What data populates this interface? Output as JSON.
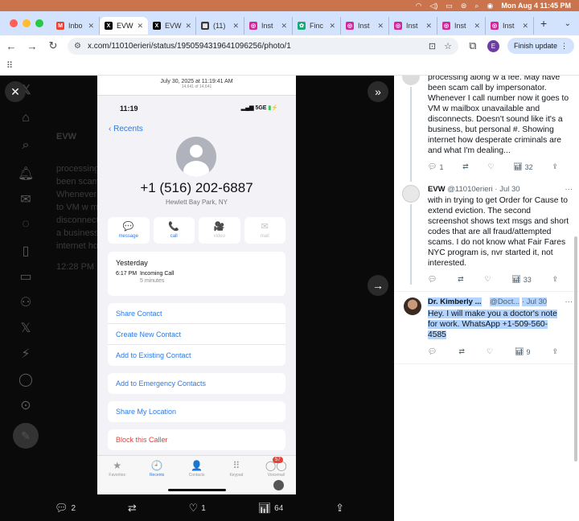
{
  "menubar": {
    "clock": "Mon Aug 4  11:45 PM"
  },
  "tabs": [
    {
      "label": "Inbo",
      "color": "#ea4335",
      "glyph": "M"
    },
    {
      "label": "EVW",
      "color": "#000000",
      "glyph": "X",
      "active": true
    },
    {
      "label": "EVW",
      "color": "#000000",
      "glyph": "X"
    },
    {
      "label": "(11)",
      "color": "#3b3b3b",
      "glyph": "▦"
    },
    {
      "label": "Inst",
      "color": "#d6249f",
      "glyph": "◎"
    },
    {
      "label": "Finc",
      "color": "#19a974",
      "glyph": "✿"
    },
    {
      "label": "Inst",
      "color": "#d6249f",
      "glyph": "◎"
    },
    {
      "label": "Inst",
      "color": "#d6249f",
      "glyph": "◎"
    },
    {
      "label": "Inst",
      "color": "#d6249f",
      "glyph": "◎"
    },
    {
      "label": "Inst",
      "color": "#d6249f",
      "glyph": "◎"
    }
  ],
  "toolbar": {
    "url": "x.com/11010erieri/status/1950594319641096256/photo/1",
    "profile_letter": "E",
    "finish_update": "Finish update"
  },
  "background_tweet": {
    "author": "EVW",
    "lines": [
      "processing along w a fee. May have",
      "been scam call by impersonator.",
      "Whenever I call number now it goes",
      "to VM w mailbox unavailable and",
      "disconnects. Doesn't sound like it's",
      "a business, but personal #. Showing",
      "internet how desperate criminals are"
    ],
    "time": "12:28 PM"
  },
  "phone": {
    "header": "July 30, 2025 at 11:19:41 AM",
    "header_sub": "14,641 of 14,641",
    "time": "11:19",
    "signal": "5GE",
    "back": "Recents",
    "number": "+1 (516) 202-6887",
    "location": "Hewlett Bay Park, NY",
    "actions": [
      {
        "label": "message",
        "icon": "💬",
        "dim": false
      },
      {
        "label": "call",
        "icon": "📞",
        "dim": false
      },
      {
        "label": "video",
        "icon": "🎥",
        "dim": true
      },
      {
        "label": "mail",
        "icon": "✉",
        "dim": true
      }
    ],
    "call_day": "Yesterday",
    "call_time": "6:17 PM",
    "call_type": "Incoming Call",
    "call_duration": "5 minutes",
    "contact_options": [
      "Share Contact",
      "Create New Contact",
      "Add to Existing Contact"
    ],
    "emergency": "Add to Emergency Contacts",
    "share_location": "Share My Location",
    "block": "Block this Caller",
    "tabbar": [
      {
        "label": "Favorites",
        "icon": "★",
        "on": false
      },
      {
        "label": "Recents",
        "icon": "🕘",
        "on": true
      },
      {
        "label": "Contacts",
        "icon": "👤",
        "on": false
      },
      {
        "label": "Keypad",
        "icon": "⠿",
        "on": false
      },
      {
        "label": "Voicemail",
        "icon": "◯◯",
        "on": false
      }
    ],
    "voicemail_badge": "57"
  },
  "photo_actions": {
    "replies": "2",
    "likes": "1",
    "views": "64"
  },
  "replies": [
    {
      "text": "processing along w a fee. May have been scam call by impersonator. Whenever I call number now it goes to VM w mailbox unavailable and disconnects. Doesn't sound like it's a business, but personal #. Showing internet how desperate criminals are and what I'm dealing...",
      "replies": "1",
      "views": "32"
    },
    {
      "name": "EVW",
      "handle": "@11010erieri",
      "date": "· Jul 30",
      "text": "with in trying to get Order for Cause to extend eviction. The second screenshot shows text msgs and short codes that are all fraud/attempted scams. I do not know what Fair Fares NYC program is, nvr started it, not interested.",
      "views": "33"
    },
    {
      "name": "Dr. Kimberly ...",
      "handle": "@Doct...",
      "date": "· Jul 30",
      "text_lines": [
        "Hey. I will make you a doctor's note",
        "for work.  WhatsApp +1-509-560-",
        "4585"
      ],
      "views": "9"
    }
  ]
}
